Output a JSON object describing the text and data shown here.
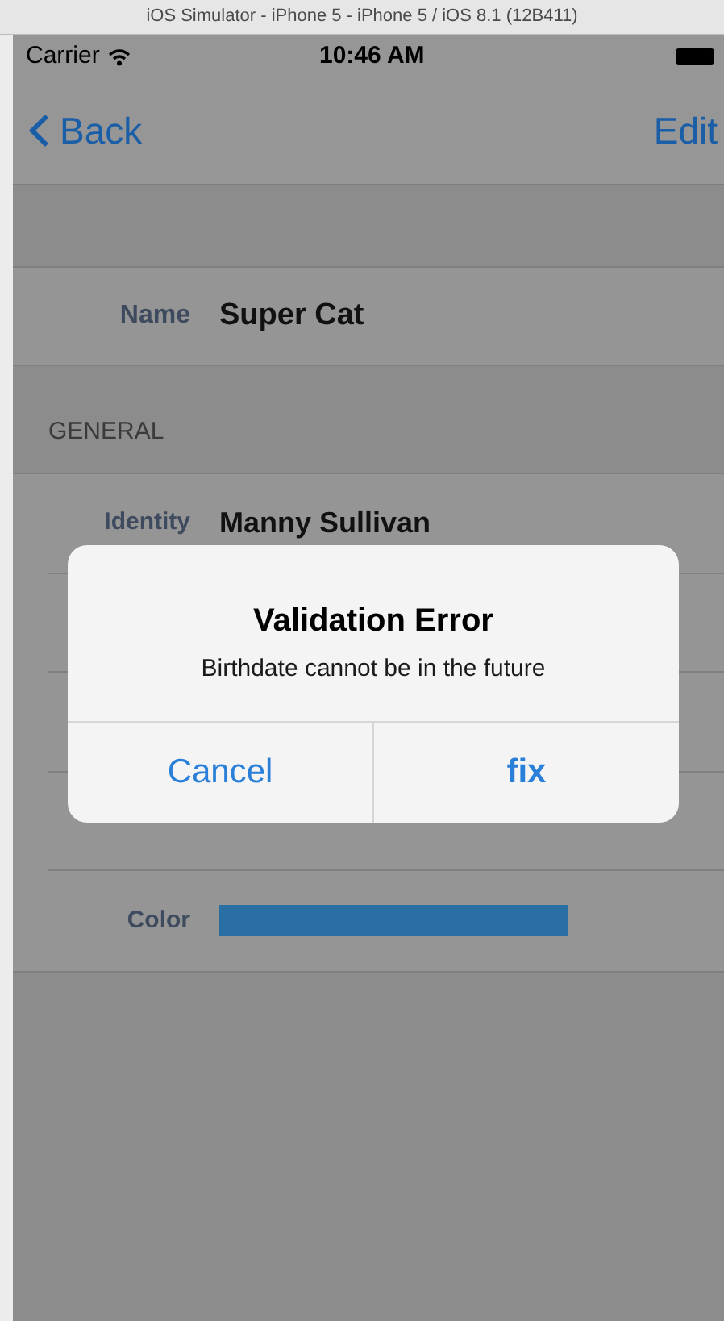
{
  "window": {
    "title": "iOS Simulator - iPhone 5 - iPhone 5 / iOS 8.1 (12B411)"
  },
  "status_bar": {
    "carrier": "Carrier",
    "time": "10:46 AM"
  },
  "nav_bar": {
    "back": "Back",
    "action": "Edit"
  },
  "header_row": {
    "label": "Name",
    "value": "Super Cat"
  },
  "section": {
    "title": "GENERAL",
    "rows": [
      {
        "kind": "text",
        "label": "Identity",
        "value": "Manny Sullivan"
      },
      {
        "kind": "hidden"
      },
      {
        "kind": "hidden"
      },
      {
        "kind": "hidden"
      },
      {
        "kind": "swatch",
        "label": "Color",
        "color": "#2a6fa3"
      }
    ]
  },
  "alert": {
    "title": "Validation Error",
    "message": "Birthdate cannot be in the future",
    "buttons": [
      {
        "label": "Cancel",
        "bold": false
      },
      {
        "label": "fix",
        "bold": true
      }
    ]
  }
}
